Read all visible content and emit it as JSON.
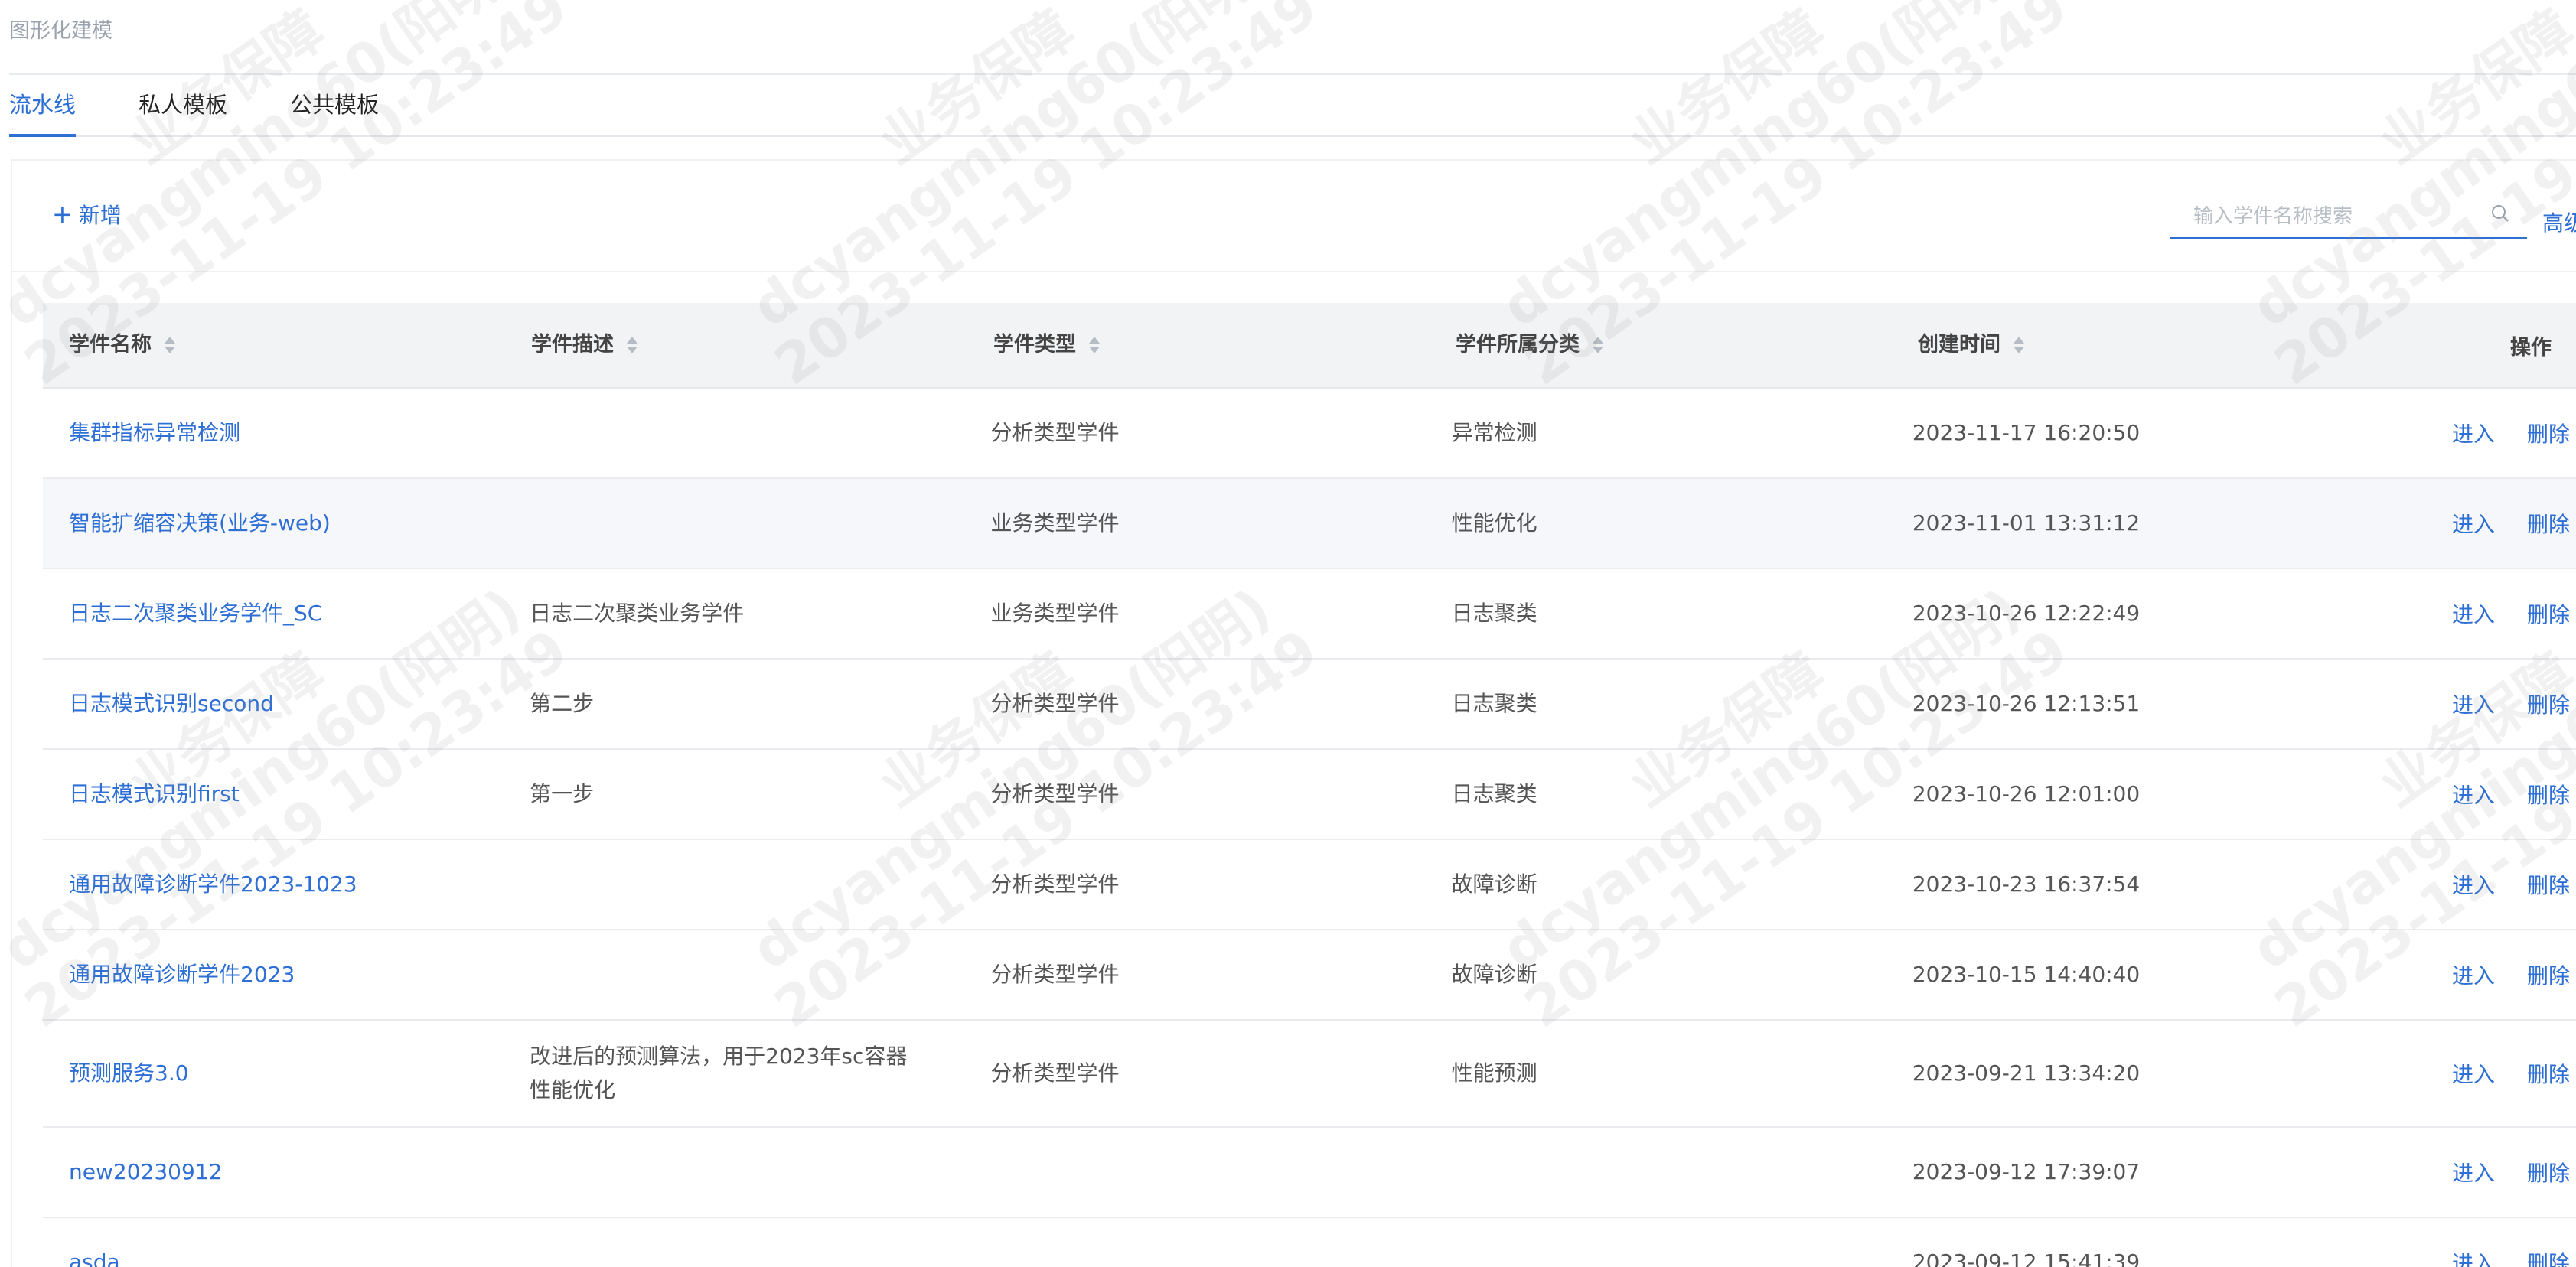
{
  "breadcrumb": "图形化建模",
  "tabs": [
    {
      "label": "流水线",
      "active": true
    },
    {
      "label": "私人模板",
      "active": false
    },
    {
      "label": "公共模板",
      "active": false
    }
  ],
  "toolbar": {
    "add_label": "新增",
    "search_placeholder": "输入学件名称搜索",
    "advanced_label": "高级"
  },
  "table": {
    "columns": [
      "学件名称",
      "学件描述",
      "学件类型",
      "学件所属分类",
      "创建时间",
      "操作"
    ],
    "actions": {
      "enter": "进入",
      "delete": "删除"
    },
    "rows": [
      {
        "name": "集群指标异常检测",
        "desc": "",
        "type": "分析类型学件",
        "category": "异常检测",
        "time": "2023-11-17 16:20:50"
      },
      {
        "name": "智能扩缩容决策(业务-web)",
        "desc": "",
        "type": "业务类型学件",
        "category": "性能优化",
        "time": "2023-11-01 13:31:12"
      },
      {
        "name": "日志二次聚类业务学件_SC",
        "desc": "日志二次聚类业务学件",
        "type": "业务类型学件",
        "category": "日志聚类",
        "time": "2023-10-26 12:22:49"
      },
      {
        "name": "日志模式识别second",
        "desc": "第二步",
        "type": "分析类型学件",
        "category": "日志聚类",
        "time": "2023-10-26 12:13:51"
      },
      {
        "name": "日志模式识别first",
        "desc": "第一步",
        "type": "分析类型学件",
        "category": "日志聚类",
        "time": "2023-10-26 12:01:00"
      },
      {
        "name": "通用故障诊断学件2023-1023",
        "desc": "",
        "type": "分析类型学件",
        "category": "故障诊断",
        "time": "2023-10-23 16:37:54"
      },
      {
        "name": "通用故障诊断学件2023",
        "desc": "",
        "type": "分析类型学件",
        "category": "故障诊断",
        "time": "2023-10-15 14:40:40"
      },
      {
        "name": "预测服务3.0",
        "desc": "改进后的预测算法，用于2023年sc容器性能优化",
        "type": "分析类型学件",
        "category": "性能预测",
        "time": "2023-09-21 13:34:20"
      },
      {
        "name": "new20230912",
        "desc": "",
        "type": "",
        "category": "",
        "time": "2023-09-12 17:39:07"
      },
      {
        "name": "asda",
        "desc": "",
        "type": "",
        "category": "",
        "time": "2023-09-12 15:41:39"
      }
    ]
  },
  "watermark": {
    "line1": "业务保障",
    "line2": "dcyangming60(阳明)",
    "line3": "2023-11-19 10:23:49"
  }
}
